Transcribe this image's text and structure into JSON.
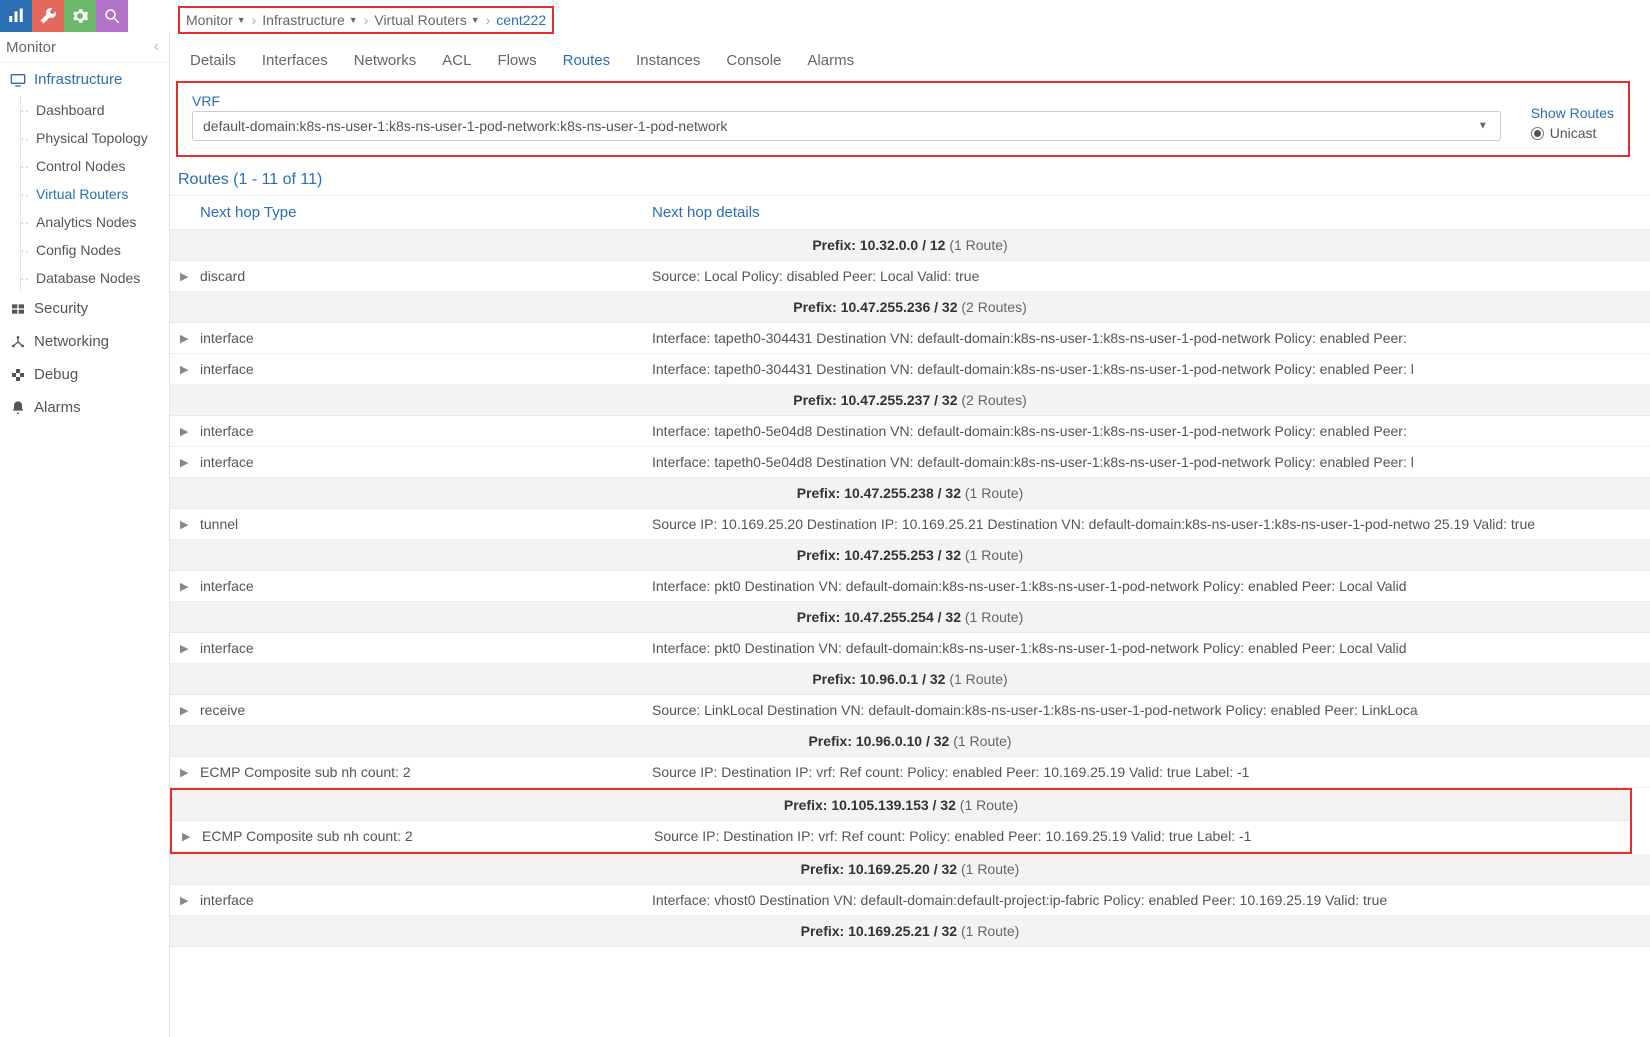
{
  "topIcons": [
    {
      "name": "chart-icon",
      "color": "#2a6fb4"
    },
    {
      "name": "wrench-icon",
      "color": "#e36a5a"
    },
    {
      "name": "gear-icon",
      "color": "#6cb96c"
    },
    {
      "name": "search-icon",
      "color": "#b073c9"
    }
  ],
  "sidebar": {
    "title": "Monitor",
    "sections": [
      {
        "label": "Infrastructure",
        "icon": "monitor",
        "selected": true,
        "children": [
          {
            "label": "Dashboard"
          },
          {
            "label": "Physical Topology"
          },
          {
            "label": "Control Nodes"
          },
          {
            "label": "Virtual Routers",
            "selected": true
          },
          {
            "label": "Analytics Nodes"
          },
          {
            "label": "Config Nodes"
          },
          {
            "label": "Database Nodes"
          }
        ]
      },
      {
        "label": "Security",
        "icon": "security"
      },
      {
        "label": "Networking",
        "icon": "network"
      },
      {
        "label": "Debug",
        "icon": "debug"
      },
      {
        "label": "Alarms",
        "icon": "bell"
      }
    ]
  },
  "breadcrumb": [
    {
      "label": "Monitor",
      "dropdown": true
    },
    {
      "label": "Infrastructure",
      "dropdown": true
    },
    {
      "label": "Virtual Routers",
      "dropdown": true
    },
    {
      "label": "cent222",
      "dropdown": false,
      "link": true
    }
  ],
  "tabs": [
    "Details",
    "Interfaces",
    "Networks",
    "ACL",
    "Flows",
    "Routes",
    "Instances",
    "Console",
    "Alarms"
  ],
  "activeTab": "Routes",
  "filter": {
    "vrfLabel": "VRF",
    "vrfValue": "default-domain:k8s-ns-user-1:k8s-ns-user-1-pod-network:k8s-ns-user-1-pod-network",
    "showRoutesLabel": "Show Routes",
    "radioLabel": "Unicast"
  },
  "routesHeading": "Routes (1 - 11 of 11)",
  "columns": {
    "type": "Next hop Type",
    "details": "Next hop details"
  },
  "prefixWord": "Prefix:",
  "rows": [
    {
      "kind": "prefix",
      "prefix": "10.32.0.0 / 12",
      "count": "(1 Route)"
    },
    {
      "kind": "route",
      "type": "discard",
      "details": "Source: Local   Policy: disabled   Peer: Local   Valid: true"
    },
    {
      "kind": "prefix",
      "prefix": "10.47.255.236 / 32",
      "count": "(2 Routes)"
    },
    {
      "kind": "route",
      "type": "interface",
      "details": "Interface: tapeth0-304431   Destination VN: default-domain:k8s-ns-user-1:k8s-ns-user-1-pod-network   Policy: enabled   Peer: "
    },
    {
      "kind": "route",
      "type": "interface",
      "details": "Interface: tapeth0-304431   Destination VN: default-domain:k8s-ns-user-1:k8s-ns-user-1-pod-network   Policy: enabled   Peer: l"
    },
    {
      "kind": "prefix",
      "prefix": "10.47.255.237 / 32",
      "count": "(2 Routes)"
    },
    {
      "kind": "route",
      "type": "interface",
      "details": "Interface: tapeth0-5e04d8   Destination VN: default-domain:k8s-ns-user-1:k8s-ns-user-1-pod-network   Policy: enabled   Peer: "
    },
    {
      "kind": "route",
      "type": "interface",
      "details": "Interface: tapeth0-5e04d8   Destination VN: default-domain:k8s-ns-user-1:k8s-ns-user-1-pod-network   Policy: enabled   Peer: l"
    },
    {
      "kind": "prefix",
      "prefix": "10.47.255.238 / 32",
      "count": "(1 Route)"
    },
    {
      "kind": "route",
      "type": "tunnel",
      "details": "Source IP: 10.169.25.20   Destination IP: 10.169.25.21   Destination VN: default-domain:k8s-ns-user-1:k8s-ns-user-1-pod-netwo 25.19   Valid: true"
    },
    {
      "kind": "prefix",
      "prefix": "10.47.255.253 / 32",
      "count": "(1 Route)"
    },
    {
      "kind": "route",
      "type": "interface",
      "details": "Interface: pkt0   Destination VN: default-domain:k8s-ns-user-1:k8s-ns-user-1-pod-network   Policy: enabled   Peer: Local   Valid"
    },
    {
      "kind": "prefix",
      "prefix": "10.47.255.254 / 32",
      "count": "(1 Route)"
    },
    {
      "kind": "route",
      "type": "interface",
      "details": "Interface: pkt0   Destination VN: default-domain:k8s-ns-user-1:k8s-ns-user-1-pod-network   Policy: enabled   Peer: Local   Valid"
    },
    {
      "kind": "prefix",
      "prefix": "10.96.0.1 / 32",
      "count": "(1 Route)"
    },
    {
      "kind": "route",
      "type": "receive",
      "details": "Source: LinkLocal   Destination VN: default-domain:k8s-ns-user-1:k8s-ns-user-1-pod-network   Policy: enabled   Peer: LinkLoca"
    },
    {
      "kind": "prefix",
      "prefix": "10.96.0.10 / 32",
      "count": "(1 Route)"
    },
    {
      "kind": "route",
      "type": "ECMP Composite sub nh count: 2",
      "details": "Source IP:    Destination IP:    vrf:    Ref count:    Policy: enabled   Peer: 10.169.25.19   Valid: true   Label: -1"
    },
    {
      "kind": "prefix",
      "prefix": "10.105.139.153 / 32",
      "count": "(1 Route)",
      "hl": true
    },
    {
      "kind": "route",
      "type": "ECMP Composite sub nh count: 2",
      "details": "Source IP:    Destination IP:    vrf:    Ref count:    Policy: enabled   Peer: 10.169.25.19   Valid: true   Label: -1",
      "hl": true
    },
    {
      "kind": "prefix",
      "prefix": "10.169.25.20 / 32",
      "count": "(1 Route)"
    },
    {
      "kind": "route",
      "type": "interface",
      "details": "Interface: vhost0   Destination VN: default-domain:default-project:ip-fabric   Policy: enabled   Peer: 10.169.25.19   Valid: true"
    },
    {
      "kind": "prefix",
      "prefix": "10.169.25.21 / 32",
      "count": "(1 Route)"
    }
  ]
}
